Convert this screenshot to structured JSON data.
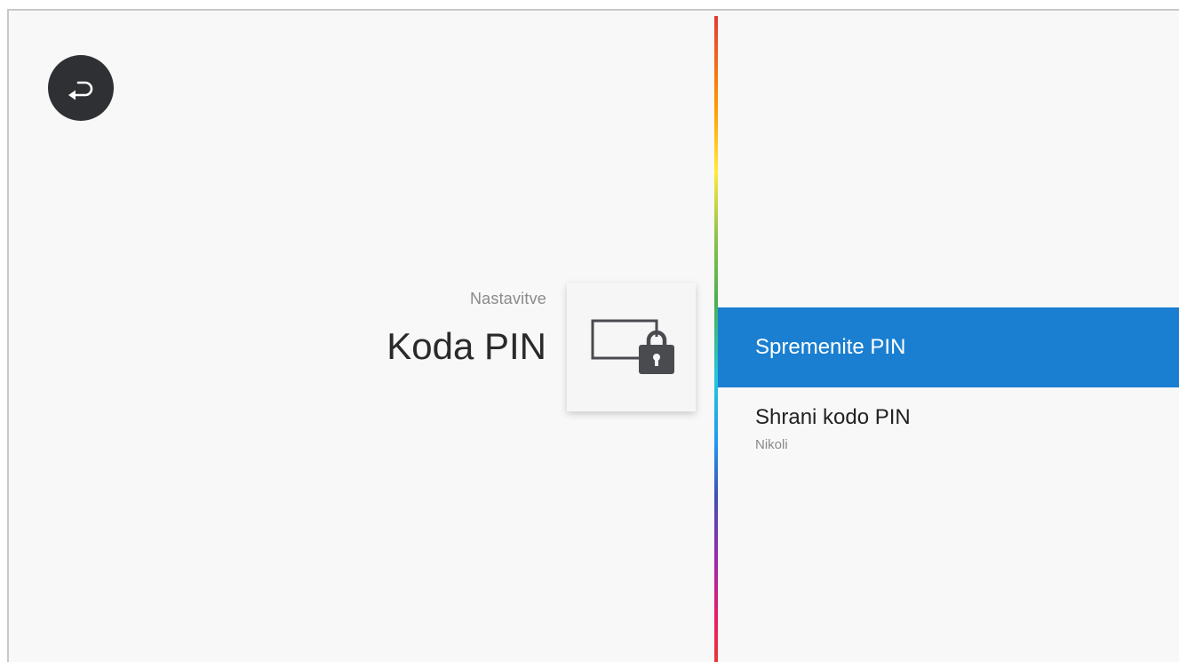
{
  "header": {
    "breadcrumb": "Nastavitve",
    "title": "Koda PIN",
    "back_icon": "back-arrow-icon",
    "category_icon": "screen-lock-icon"
  },
  "menu": {
    "items": [
      {
        "label": "Spremenite PIN",
        "selected": true
      },
      {
        "label": "Shrani kodo PIN",
        "value": "Nikoli",
        "selected": false
      }
    ]
  },
  "colors": {
    "background": "#f8f8f8",
    "selected_item": "#1a7fd0",
    "back_button": "#2f3033",
    "icon": "#4a4b4e"
  }
}
